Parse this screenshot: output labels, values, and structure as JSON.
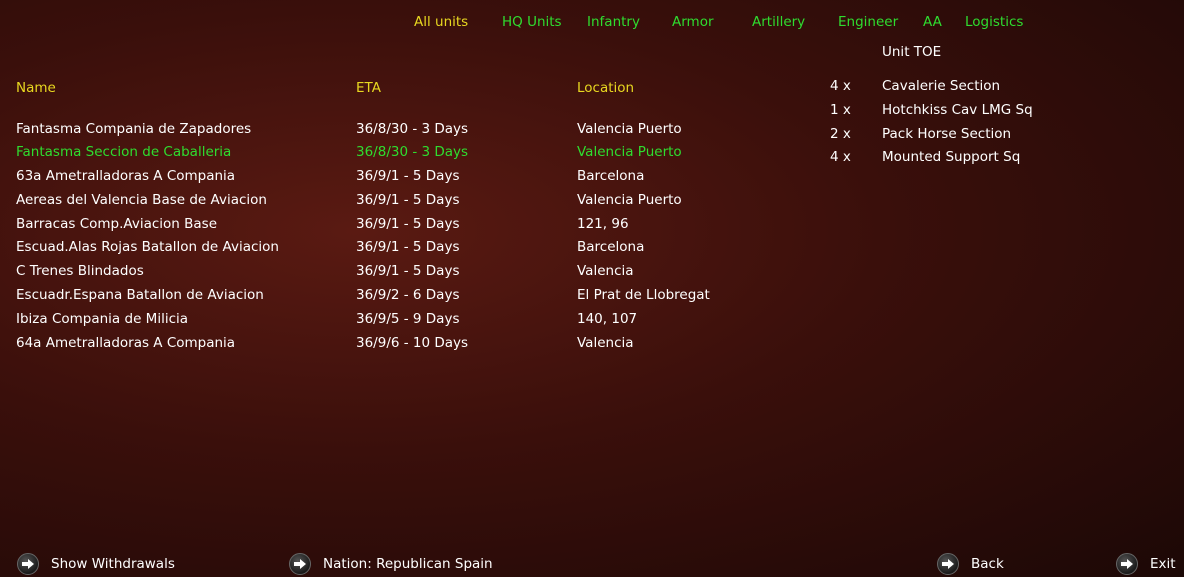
{
  "tabs": [
    {
      "label": "All units",
      "active": true
    },
    {
      "label": "HQ Units"
    },
    {
      "label": "Infantry"
    },
    {
      "label": "Armor"
    },
    {
      "label": "Artillery"
    },
    {
      "label": "Engineer"
    },
    {
      "label": "AA"
    },
    {
      "label": "Logistics"
    }
  ],
  "columns": {
    "name": "Name",
    "eta": "ETA",
    "location": "Location"
  },
  "rows": [
    {
      "name": "Fantasma Compania de Zapadores",
      "eta": "36/8/30 - 3 Days",
      "location": "Valencia Puerto"
    },
    {
      "name": "Fantasma Seccion de Caballeria",
      "eta": "36/8/30 - 3 Days",
      "location": "Valencia Puerto",
      "selected": true
    },
    {
      "name": "63a Ametralladoras A Compania",
      "eta": "36/9/1 - 5 Days",
      "location": "Barcelona"
    },
    {
      "name": "Aereas del Valencia Base de Aviacion",
      "eta": "36/9/1 - 5 Days",
      "location": "Valencia Puerto"
    },
    {
      "name": "Barracas Comp.Aviacion Base",
      "eta": "36/9/1 - 5 Days",
      "location": "121, 96"
    },
    {
      "name": "Escuad.Alas Rojas Batallon de Aviacion",
      "eta": "36/9/1 - 5 Days",
      "location": "Barcelona"
    },
    {
      "name": "C Trenes Blindados",
      "eta": "36/9/1 - 5 Days",
      "location": "Valencia"
    },
    {
      "name": "Escuadr.Espana Batallon de Aviacion",
      "eta": "36/9/2 - 6 Days",
      "location": "El Prat de Llobregat"
    },
    {
      "name": "Ibiza Compania de Milicia",
      "eta": "36/9/5 - 9 Days",
      "location": "140, 107"
    },
    {
      "name": "64a Ametralladoras A Compania",
      "eta": "36/9/6 - 10 Days",
      "location": "Valencia"
    }
  ],
  "toe": {
    "title": "Unit TOE",
    "items": [
      {
        "qty": "4 x",
        "name": "Cavalerie Section"
      },
      {
        "qty": "1 x",
        "name": "Hotchkiss Cav LMG Sq"
      },
      {
        "qty": "2 x",
        "name": "Pack Horse Section"
      },
      {
        "qty": "4 x",
        "name": "Mounted Support Sq"
      }
    ]
  },
  "buttons": {
    "show_withdrawals": "Show Withdrawals",
    "nation": "Nation: Republican Spain",
    "back": "Back",
    "exit": "Exit"
  },
  "icons": {
    "button": "arrow-right-icon"
  },
  "colors": {
    "active_tab": "#e8d820",
    "tab": "#2fdc2f",
    "header": "#e8d820",
    "selected_row": "#2fdc2f",
    "text": "#ffffff"
  }
}
